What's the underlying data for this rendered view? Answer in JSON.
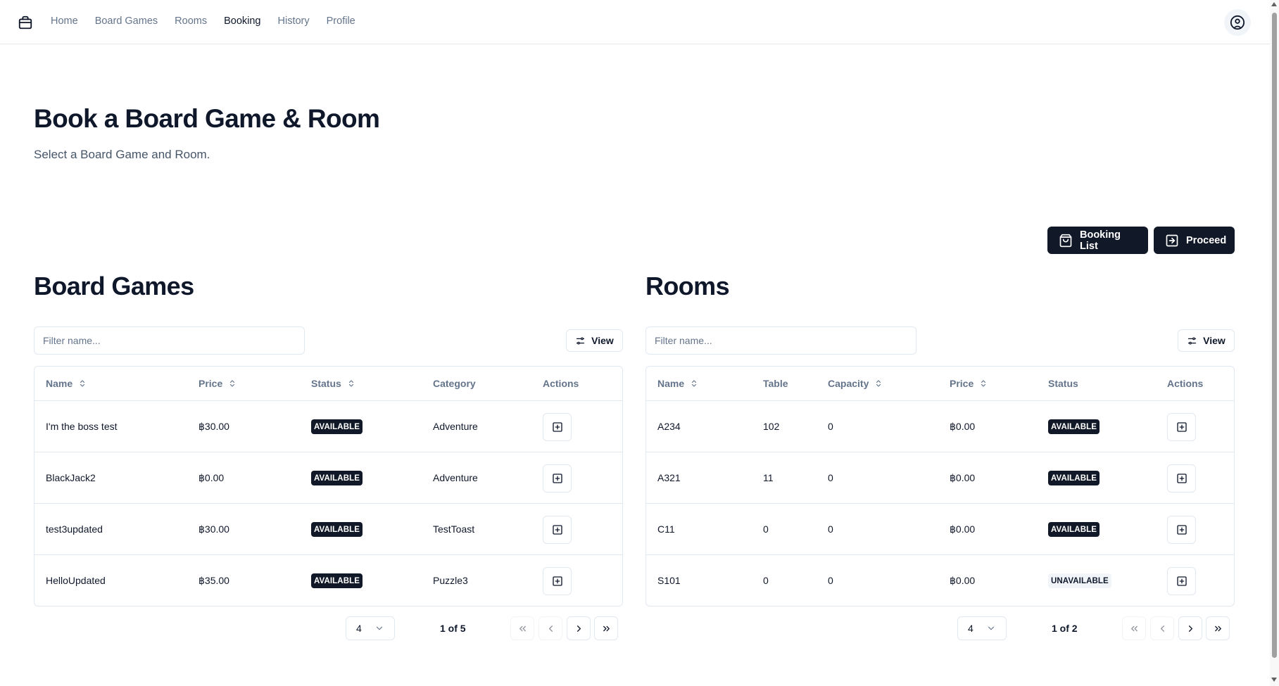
{
  "nav": {
    "links": [
      "Home",
      "Board Games",
      "Rooms",
      "Booking",
      "History",
      "Profile"
    ],
    "active": "Booking"
  },
  "page": {
    "title": "Book a Board Game & Room",
    "subtitle": "Select a Board Game and Room."
  },
  "actions": {
    "booking_list": "Booking List",
    "proceed": "Proceed"
  },
  "board_games": {
    "title": "Board Games",
    "filter_placeholder": "Filter name...",
    "view_label": "View",
    "columns": [
      "Name",
      "Price",
      "Status",
      "Category",
      "Actions"
    ],
    "rows": [
      {
        "name": "I'm the boss test",
        "price": "฿30.00",
        "status": "AVAILABLE",
        "category": "Adventure"
      },
      {
        "name": "BlackJack2",
        "price": "฿0.00",
        "status": "AVAILABLE",
        "category": "Adventure"
      },
      {
        "name": "test3updated",
        "price": "฿30.00",
        "status": "AVAILABLE",
        "category": "TestToast"
      },
      {
        "name": "HelloUpdated",
        "price": "฿35.00",
        "status": "AVAILABLE",
        "category": "Puzzle3"
      }
    ],
    "page_size": "4",
    "page_info": "1 of 5"
  },
  "rooms": {
    "title": "Rooms",
    "filter_placeholder": "Filter name...",
    "view_label": "View",
    "columns": [
      "Name",
      "Table",
      "Capacity",
      "Price",
      "Status",
      "Actions"
    ],
    "rows": [
      {
        "name": "A234",
        "table": "102",
        "capacity": "0",
        "price": "฿0.00",
        "status": "AVAILABLE"
      },
      {
        "name": "A321",
        "table": "11",
        "capacity": "0",
        "price": "฿0.00",
        "status": "AVAILABLE"
      },
      {
        "name": "C11",
        "table": "0",
        "capacity": "0",
        "price": "฿0.00",
        "status": "AVAILABLE"
      },
      {
        "name": "S101",
        "table": "0",
        "capacity": "0",
        "price": "฿0.00",
        "status": "UNAVAILABLE"
      }
    ],
    "page_size": "4",
    "page_info": "1 of 2"
  },
  "icons": {
    "logo": "box-icon",
    "avatar": "user-circle-icon",
    "booking_list": "shopping-bag-icon",
    "proceed": "arrow-right-square-icon",
    "view": "sliders-icon",
    "sort": "chevrons-up-down-icon",
    "row_action": "plus-square-icon",
    "page_size": "chevron-down-icon",
    "first": "chevrons-left-icon",
    "prev": "chevron-left-icon",
    "next": "chevron-right-icon",
    "last": "chevrons-right-icon"
  },
  "colors": {
    "primary": "#111827",
    "muted_text": "#64748b",
    "border": "#e2e8f0"
  }
}
